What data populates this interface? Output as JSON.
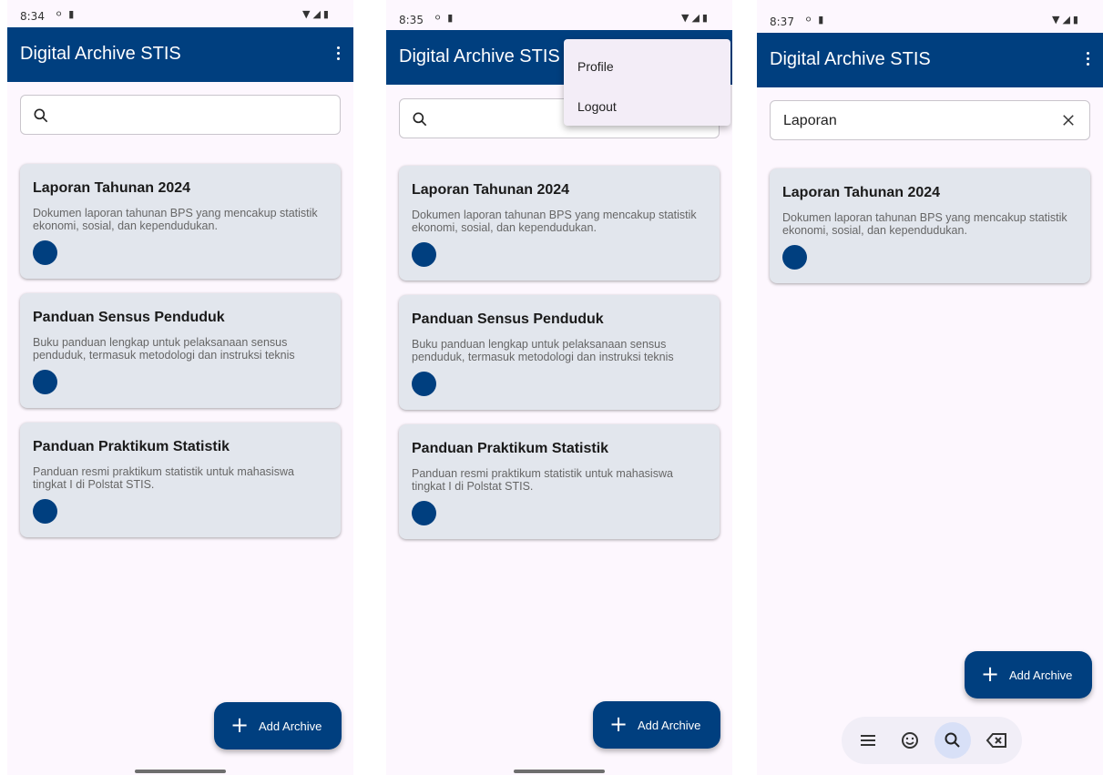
{
  "screens": [
    {
      "status": {
        "time": "8:34"
      },
      "app_title": "Digital Archive STIS",
      "search": {
        "value": ""
      },
      "cards": [
        {
          "title": "Laporan Tahunan 2024",
          "desc": "Dokumen laporan tahunan BPS yang mencakup statistik ekonomi, sosial, dan kependudukan."
        },
        {
          "title": "Panduan Sensus Penduduk",
          "desc": "Buku panduan lengkap untuk pelaksanaan sensus penduduk, termasuk metodologi dan instruksi teknis"
        },
        {
          "title": "Panduan Praktikum Statistik",
          "desc": "Panduan resmi praktikum statistik untuk mahasiswa tingkat I di Polstat STIS."
        }
      ],
      "fab_label": "Add Archive"
    },
    {
      "status": {
        "time": "8:35"
      },
      "app_title": "Digital Archive STIS",
      "menu": [
        "Profile",
        "Logout"
      ],
      "cards": [
        {
          "title": "Laporan Tahunan 2024",
          "desc": "Dokumen laporan tahunan BPS yang mencakup statistik ekonomi, sosial, dan kependudukan."
        },
        {
          "title": "Panduan Sensus Penduduk",
          "desc": "Buku panduan lengkap untuk pelaksanaan sensus penduduk, termasuk metodologi dan instruksi teknis"
        },
        {
          "title": "Panduan Praktikum Statistik",
          "desc": "Panduan resmi praktikum statistik untuk mahasiswa tingkat I di Polstat STIS."
        }
      ],
      "fab_label": "Add Archive"
    },
    {
      "status": {
        "time": "8:37"
      },
      "app_title": "Digital Archive STIS",
      "search": {
        "value": "Laporan"
      },
      "cards": [
        {
          "title": "Laporan Tahunan 2024",
          "desc": "Dokumen laporan tahunan BPS yang mencakup statistik ekonomi, sosial, dan kependudukan."
        }
      ],
      "fab_label": "Add Archive"
    }
  ],
  "colors": {
    "primary": "#003f7f",
    "background": "#fdf7fe",
    "card": "#e2e6ed"
  }
}
